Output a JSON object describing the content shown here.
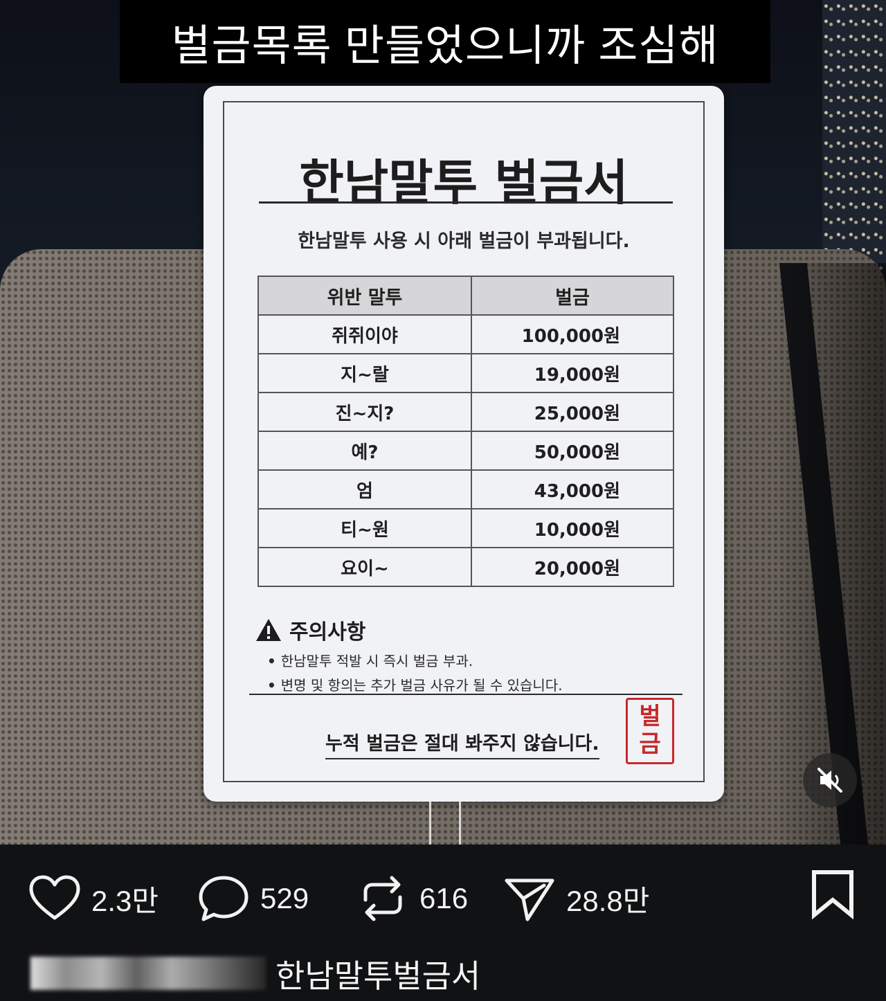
{
  "overlay_caption": "벌금목록 만들었으니까 조심해",
  "document": {
    "title": "한남말투 벌금서",
    "subtitle": "한남말투 사용 시 아래 벌금이 부과됩니다.",
    "table": {
      "headers": [
        "위반 말투",
        "벌금"
      ],
      "rows": [
        {
          "word": "쥐쥐이야",
          "fine": "100,000원"
        },
        {
          "word": "지~랄",
          "fine": "19,000원"
        },
        {
          "word": "진~지?",
          "fine": "25,000원"
        },
        {
          "word": "예?",
          "fine": "50,000원"
        },
        {
          "word": "엄",
          "fine": "43,000원"
        },
        {
          "word": "티~원",
          "fine": "10,000원"
        },
        {
          "word": "요이~",
          "fine": "20,000원"
        }
      ]
    },
    "caution_title": "주의사항",
    "caution_items": [
      "한남말투 적발 시 즉시 벌금 부과.",
      "변명 및 항의는 추가 벌금 사유가 될 수 있습니다."
    ],
    "footer": "누적 벌금은 절대 봐주지 않습니다.",
    "stamp": [
      "벌",
      "금"
    ]
  },
  "actions": {
    "likes": "2.3만",
    "comments": "529",
    "reposts": "616",
    "shares": "28.8만"
  },
  "post_caption": "한남말투벌금서",
  "colors": {
    "background": "#111214",
    "paper": "#f1f2f5",
    "stamp_red": "#c8282b",
    "table_header": "#d6d6d9"
  },
  "icons": {
    "like": "heart-icon",
    "comment": "comment-bubble-icon",
    "repost": "repost-icon",
    "share": "share-send-icon",
    "save": "bookmark-icon",
    "mute": "speaker-muted-icon",
    "warning": "warning-triangle-icon"
  }
}
